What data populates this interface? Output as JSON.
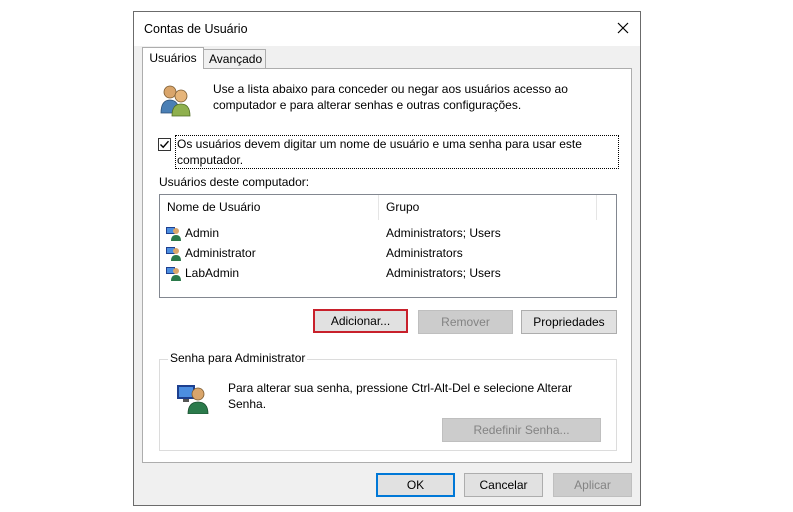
{
  "window": {
    "title": "Contas de Usuário"
  },
  "tabs": [
    {
      "label": "Usuários",
      "active": true
    },
    {
      "label": "Avançado",
      "active": false
    }
  ],
  "intro_text": "Use a lista abaixo para conceder ou negar aos usuários acesso ao computador e para alterar senhas e outras configurações.",
  "require_login": {
    "checked": true,
    "label": "Os usuários devem digitar um nome de usuário e uma senha para usar este computador."
  },
  "users_label": "Usuários deste computador:",
  "table": {
    "columns": [
      "Nome de Usuário",
      "Grupo"
    ],
    "rows": [
      {
        "name": "Admin",
        "group": "Administrators; Users"
      },
      {
        "name": "Administrator",
        "group": "Administrators"
      },
      {
        "name": "LabAdmin",
        "group": "Administrators; Users"
      }
    ]
  },
  "user_buttons": {
    "add": "Adicionar...",
    "remove": "Remover",
    "properties": "Propriedades"
  },
  "admin_password": {
    "group_title": "Senha para Administrator",
    "text": "Para alterar sua senha, pressione Ctrl-Alt-Del e selecione Alterar Senha.",
    "reset_button": "Redefinir Senha..."
  },
  "footer": {
    "ok": "OK",
    "cancel": "Cancelar",
    "apply": "Aplicar"
  },
  "icons": {
    "close": "close-icon",
    "users_group": "users-group-icon",
    "user": "user-icon",
    "admin_user": "admin-user-icon"
  },
  "colors": {
    "highlight_border": "#c8202b",
    "default_button_border": "#0078d7",
    "disabled_text": "#838383"
  }
}
